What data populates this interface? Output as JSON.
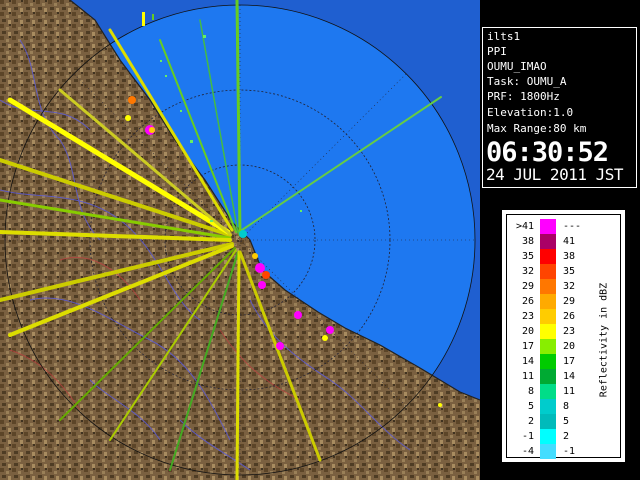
{
  "info": {
    "station": "ilts1",
    "mode": "PPI",
    "product": "OUMU_IMAO",
    "task": "Task: OUMU_A",
    "prf": "PRF: 1800Hz",
    "elevation": "Elevation:1.0",
    "max_range": "Max Range:80 km",
    "time": "06:30:52",
    "date": "24 JUL 2011 JST"
  },
  "legend": {
    "title": "Reflectivity in dBZ",
    "rows": [
      {
        "lo": ">41",
        "hi": "---",
        "color": "#ff00ff"
      },
      {
        "lo": "38",
        "hi": "41",
        "color": "#aa0066"
      },
      {
        "lo": "35",
        "hi": "38",
        "color": "#ff0000"
      },
      {
        "lo": "32",
        "hi": "35",
        "color": "#ff4400"
      },
      {
        "lo": "29",
        "hi": "32",
        "color": "#ff7700"
      },
      {
        "lo": "26",
        "hi": "29",
        "color": "#ffaa00"
      },
      {
        "lo": "23",
        "hi": "26",
        "color": "#ffcc00"
      },
      {
        "lo": "20",
        "hi": "23",
        "color": "#ffff00"
      },
      {
        "lo": "17",
        "hi": "20",
        "color": "#88ee00"
      },
      {
        "lo": "14",
        "hi": "17",
        "color": "#00cc00"
      },
      {
        "lo": "11",
        "hi": "14",
        "color": "#00aa33"
      },
      {
        "lo": "8",
        "hi": "11",
        "color": "#00dd88"
      },
      {
        "lo": "5",
        "hi": "8",
        "color": "#00cccc"
      },
      {
        "lo": "2",
        "hi": "5",
        "color": "#00bbbb"
      },
      {
        "lo": "-1",
        "hi": "2",
        "color": "#00ffff"
      },
      {
        "lo": "-4",
        "hi": "-1",
        "color": "#44ddff"
      }
    ]
  },
  "colors": {
    "sea": "#1e78f0",
    "sea_outer": "#1f5fd0",
    "land": "#7a6040"
  }
}
